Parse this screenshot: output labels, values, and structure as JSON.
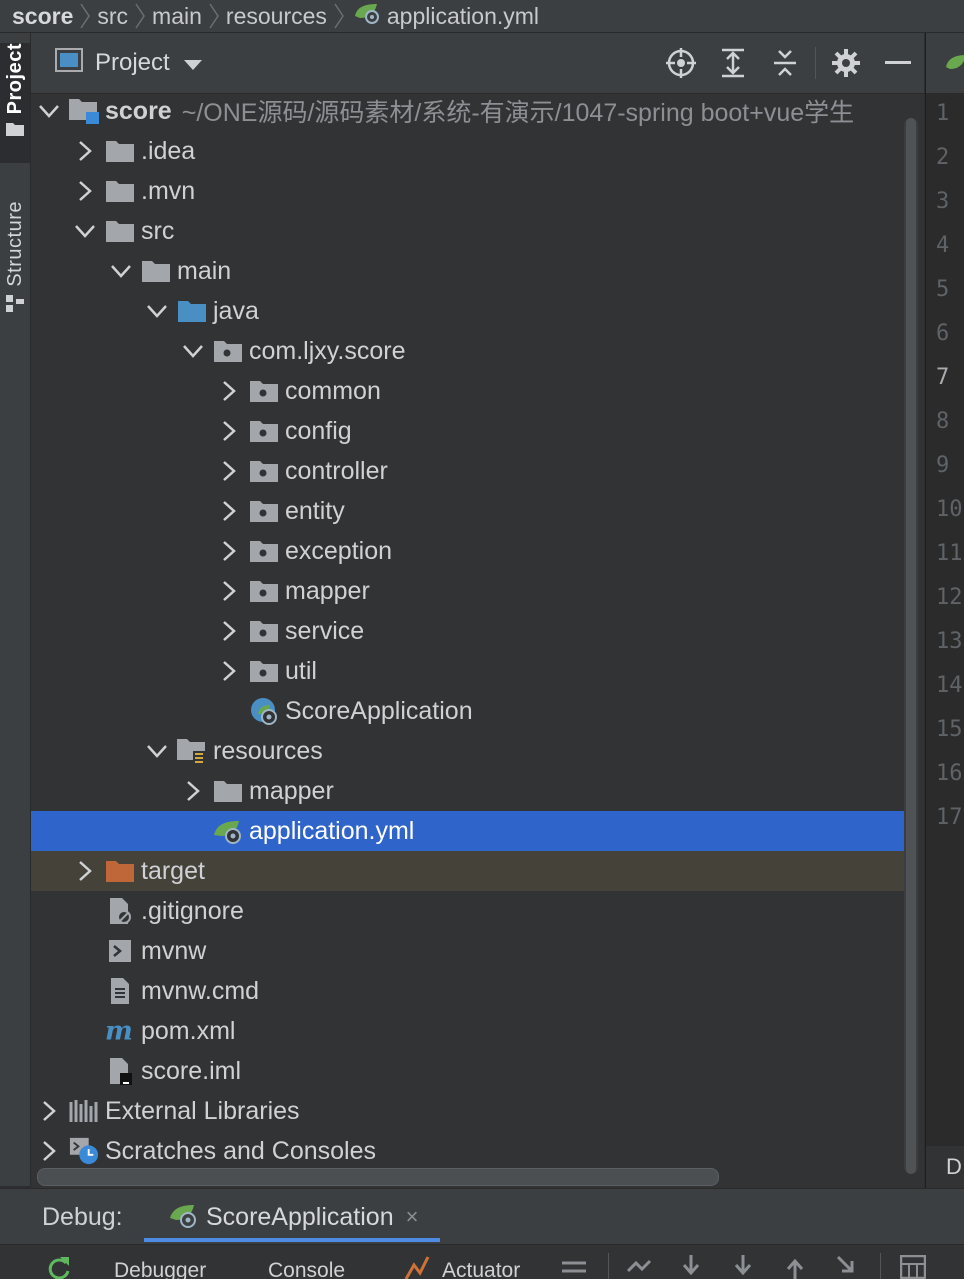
{
  "breadcrumb": [
    "score",
    "src",
    "main",
    "resources",
    "application.yml"
  ],
  "sidebar": {
    "project_tab": "Project",
    "structure_tab": "Structure"
  },
  "panel": {
    "title": "Project",
    "header_icons": [
      "locate-icon",
      "expand-all-icon",
      "collapse-all-icon",
      "gear-icon",
      "minimize-icon"
    ]
  },
  "tree": [
    {
      "label": "score",
      "path": "~/ONE源码/源码素材/系统-有演示/1047-spring boot+vue学生",
      "depth": 0,
      "expand": "open",
      "icon": "module-folder-icon",
      "bold": true
    },
    {
      "label": ".idea",
      "depth": 1,
      "expand": "closed",
      "icon": "folder-icon"
    },
    {
      "label": ".mvn",
      "depth": 1,
      "expand": "closed",
      "icon": "folder-icon"
    },
    {
      "label": "src",
      "depth": 1,
      "expand": "open",
      "icon": "folder-icon"
    },
    {
      "label": "main",
      "depth": 2,
      "expand": "open",
      "icon": "folder-icon"
    },
    {
      "label": "java",
      "depth": 3,
      "expand": "open",
      "icon": "source-folder-icon"
    },
    {
      "label": "com.ljxy.score",
      "depth": 4,
      "expand": "open",
      "icon": "package-icon"
    },
    {
      "label": "common",
      "depth": 5,
      "expand": "closed",
      "icon": "package-icon"
    },
    {
      "label": "config",
      "depth": 5,
      "expand": "closed",
      "icon": "package-icon"
    },
    {
      "label": "controller",
      "depth": 5,
      "expand": "closed",
      "icon": "package-icon"
    },
    {
      "label": "entity",
      "depth": 5,
      "expand": "closed",
      "icon": "package-icon"
    },
    {
      "label": "exception",
      "depth": 5,
      "expand": "closed",
      "icon": "package-icon"
    },
    {
      "label": "mapper",
      "depth": 5,
      "expand": "closed",
      "icon": "package-icon"
    },
    {
      "label": "service",
      "depth": 5,
      "expand": "closed",
      "icon": "package-icon"
    },
    {
      "label": "util",
      "depth": 5,
      "expand": "closed",
      "icon": "package-icon"
    },
    {
      "label": "ScoreApplication",
      "depth": 5,
      "expand": "none",
      "icon": "spring-class-icon"
    },
    {
      "label": "resources",
      "depth": 3,
      "expand": "open",
      "icon": "resources-folder-icon"
    },
    {
      "label": "mapper",
      "depth": 4,
      "expand": "closed",
      "icon": "folder-icon"
    },
    {
      "label": "application.yml",
      "depth": 4,
      "expand": "none",
      "icon": "spring-yml-icon",
      "selected": true
    },
    {
      "label": "target",
      "depth": 1,
      "expand": "closed",
      "icon": "excluded-folder-icon",
      "excluded": true
    },
    {
      "label": ".gitignore",
      "depth": 1,
      "expand": "none",
      "icon": "ignore-file-icon"
    },
    {
      "label": "mvnw",
      "depth": 1,
      "expand": "none",
      "icon": "shell-file-icon"
    },
    {
      "label": "mvnw.cmd",
      "depth": 1,
      "expand": "none",
      "icon": "text-file-icon"
    },
    {
      "label": "pom.xml",
      "depth": 1,
      "expand": "none",
      "icon": "maven-icon"
    },
    {
      "label": "score.iml",
      "depth": 1,
      "expand": "none",
      "icon": "iml-file-icon"
    },
    {
      "label": "External Libraries",
      "depth": 0,
      "expand": "closed",
      "icon": "libraries-icon"
    },
    {
      "label": "Scratches and Consoles",
      "depth": 0,
      "expand": "closed",
      "icon": "scratches-icon"
    }
  ],
  "gutter": {
    "line_numbers": [
      "1",
      "2",
      "3",
      "4",
      "5",
      "6",
      "7",
      "8",
      "9",
      "10",
      "11",
      "12",
      "13",
      "14",
      "15",
      "16",
      "17"
    ],
    "current_line": "7",
    "bottom_text": "D"
  },
  "debug": {
    "label": "Debug:",
    "tab": "ScoreApplication",
    "close": "×"
  },
  "bottom_tabs": [
    "Debugger",
    "Console",
    "Actuator"
  ],
  "colors": {
    "selection": "#2f65ca",
    "excluded": "#45423a",
    "folder": "#a3a7ab",
    "source_folder": "#4a8fc4",
    "excluded_folder": "#c0673a",
    "spring_green": "#6aa84f"
  }
}
